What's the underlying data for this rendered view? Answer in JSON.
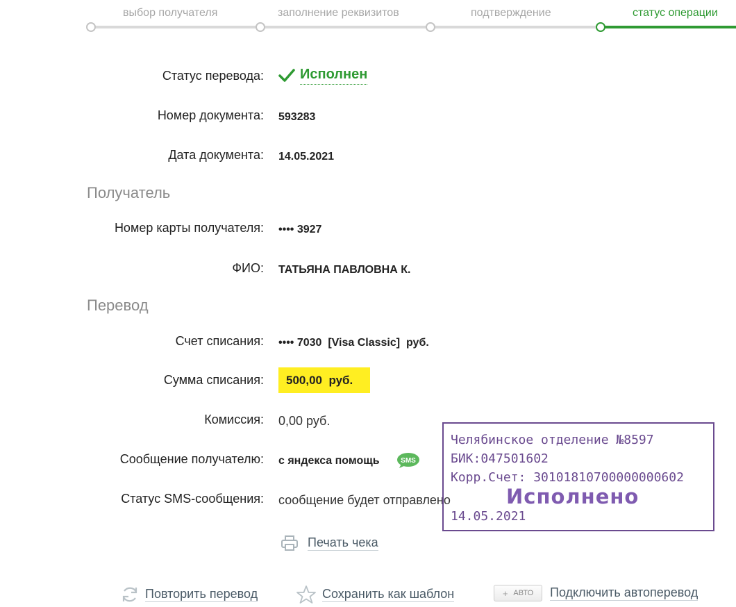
{
  "steps": [
    {
      "label": "выбор получателя"
    },
    {
      "label": "заполнение реквизитов"
    },
    {
      "label": "подтверждение"
    },
    {
      "label": "статус операции"
    }
  ],
  "status": {
    "label": "Статус перевода:",
    "value": "Исполнен"
  },
  "doc_number": {
    "label": "Номер документа:",
    "value": "593283"
  },
  "doc_date": {
    "label": "Дата документа:",
    "value": "14.05.2021"
  },
  "recipient": {
    "title": "Получатель",
    "card": {
      "label": "Номер карты получателя:",
      "value": "•••• 3927"
    },
    "name": {
      "label": "ФИО:",
      "value": "ТАТЬЯНА ПАВЛОВНА К."
    }
  },
  "transfer": {
    "title": "Перевод",
    "account": {
      "label": "Счет списания:",
      "value": "•••• 7030  [Visa Classic]  руб."
    },
    "amount": {
      "label": "Сумма списания:",
      "value": "500,00  руб."
    },
    "fee": {
      "label": "Комиссия:",
      "value": "0,00 руб."
    },
    "message": {
      "label": "Сообщение получателю:",
      "value": "с яндекса помощь",
      "badge": "SMS"
    },
    "sms_status": {
      "label": "Статус SMS-сообщения:",
      "value": "сообщение будет отправлено"
    }
  },
  "stamp": {
    "line1": "Челябинское отделение №8597",
    "line2": "БИК:047501602",
    "line3": "Корр.Счет: 30101810700000000602",
    "line4": "14.05.2021",
    "big": "Исполнено"
  },
  "actions": {
    "print": "Печать чека",
    "repeat": "Повторить перевод",
    "save_template": "Сохранить как шаблон",
    "auto_badge_plus": "+",
    "auto_badge": "АВТО",
    "autotransfer": "Подключить автоперевод"
  },
  "colors": {
    "accent": "#2e9a32",
    "highlight": "#ffee22",
    "stamp": "#6a4a8f"
  }
}
